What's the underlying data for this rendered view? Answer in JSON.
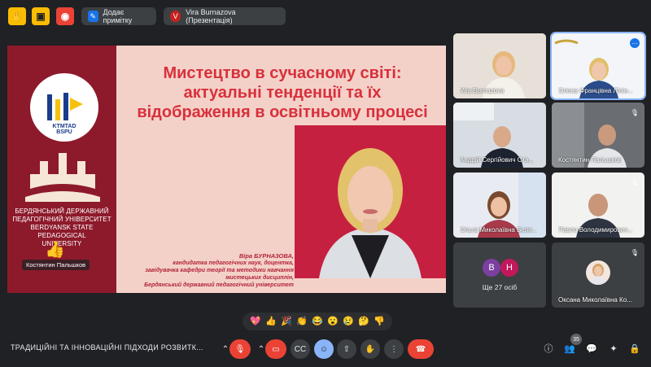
{
  "topbar": {
    "note_button": "Додає примітку",
    "presenter": "Vira Burnazova (Презентація)",
    "presenter_initial": "V"
  },
  "slide": {
    "title_line1": "Мистецтво в сучасному світі:",
    "title_line2": "актуальні тенденції та їх",
    "title_line3": "відображення в освітньому процесі",
    "logo_text": "KTMTAD",
    "logo_sub": "BSPU",
    "uni_ua_1": "БЕРДЯНСЬКИЙ ДЕРЖАВНИЙ",
    "uni_ua_2": "ПЕДАГОГІЧНИЙ УНІВЕРСИТЕТ",
    "uni_en_1": "BERDYANSK STATE PEDAGOGICAL",
    "uni_en_2": "UNIVERSITY",
    "caption_name": "Віра БУРНАЗОВА,",
    "caption_l1": "кандидатка педагогічних наук, доцентка,",
    "caption_l2": "завідувачка кафедри теорії та методики навчання",
    "caption_l3": "мистецьких дисциплін,",
    "caption_l4": "Бердянський державний педагогічний університет"
  },
  "main_name_tag": "Костянтин Пальшков",
  "participants": [
    {
      "name": "Vira Burnazova"
    },
    {
      "name": "Олена Францівна Лілін..."
    },
    {
      "name": "Андрій Сергійович Ста..."
    },
    {
      "name": "Костянтин Пальшков"
    },
    {
      "name": "Ольга Миколаївна Беля..."
    },
    {
      "name": "Павло Володимирович..."
    },
    {
      "name": "Ще 27 осіб",
      "initials": [
        "B",
        "Н"
      ]
    },
    {
      "name": "Оксана Миколаївна Ко..."
    }
  ],
  "reactions": [
    "💖",
    "👍",
    "🎉",
    "👏",
    "😂",
    "😮",
    "😢",
    "🤔",
    "👎"
  ],
  "bottom": {
    "meeting_title": "ТРАДИЦІЙНІ ТА ІННОВАЦІЙНІ ПІДХОДИ РОЗВИТК...",
    "participant_count": "35"
  },
  "colors": {
    "bg": "#202124",
    "slide_accent": "#d8303c",
    "end_call": "#ea4335",
    "active_speaker": "#8ab4f8"
  }
}
